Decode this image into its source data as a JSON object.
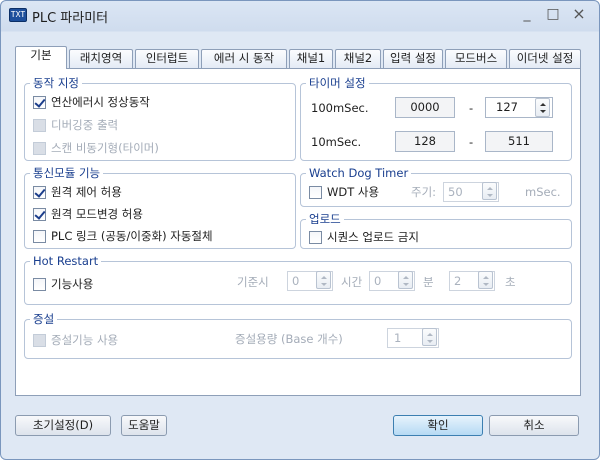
{
  "window": {
    "icon_text": "TXT",
    "title": "PLC 파라미터",
    "minimize": "_",
    "maximize": "□",
    "close": "×"
  },
  "tabs": [
    {
      "label": "기본",
      "active": true
    },
    {
      "label": "래치영역",
      "active": false
    },
    {
      "label": "인터럽트",
      "active": false
    },
    {
      "label": "에러 시 동작",
      "active": false
    },
    {
      "label": "채널1",
      "active": false
    },
    {
      "label": "채널2",
      "active": false
    },
    {
      "label": "입력 설정",
      "active": false
    },
    {
      "label": "모드버스",
      "active": false
    },
    {
      "label": "이더넷 설정",
      "active": false
    }
  ],
  "operation": {
    "legend": "동작 지정",
    "items": [
      {
        "label": "연산에러시 정상동작",
        "checked": true,
        "disabled": false
      },
      {
        "label": "디버깅중 출력",
        "checked": false,
        "disabled": true
      },
      {
        "label": "스캔 비동기형(타이머)",
        "checked": false,
        "disabled": true
      }
    ]
  },
  "timer": {
    "legend": "타이머 설정",
    "row1": {
      "label": "100mSec.",
      "from": "0000",
      "dash": "-",
      "to": "127"
    },
    "row2": {
      "label": "10mSec.",
      "from": "128",
      "dash": "-",
      "to": "511"
    }
  },
  "comm": {
    "legend": "통신모듈 기능",
    "items": [
      {
        "label": "원격 제어 허용",
        "checked": true,
        "disabled": false
      },
      {
        "label": "원격 모드변경 허용",
        "checked": true,
        "disabled": false
      },
      {
        "label": "PLC 링크 (공동/이중화) 자동절체",
        "checked": false,
        "disabled": false
      }
    ]
  },
  "watchdog": {
    "legend": "Watch Dog Timer",
    "enable_label": "WDT 사용",
    "period_label": "주기:",
    "period_value": "50",
    "unit": "mSec."
  },
  "upload": {
    "legend": "업로드",
    "item_label": "시퀀스 업로드 금지"
  },
  "hot_restart": {
    "legend": "Hot Restart",
    "enable_label": "기능사용",
    "base_label": "기준시",
    "base_value": "0",
    "time_label": "시간",
    "hour_value": "0",
    "minute_label": "분",
    "second_value": "2",
    "second_label": "초"
  },
  "expansion": {
    "legend": "증설",
    "enable_label": "증설기능 사용",
    "capacity_label": "증설용량 (Base 개수)",
    "capacity_value": "1"
  },
  "buttons": {
    "reset": "초기설정(D)",
    "help": "도움말",
    "ok": "확인",
    "cancel": "취소"
  }
}
